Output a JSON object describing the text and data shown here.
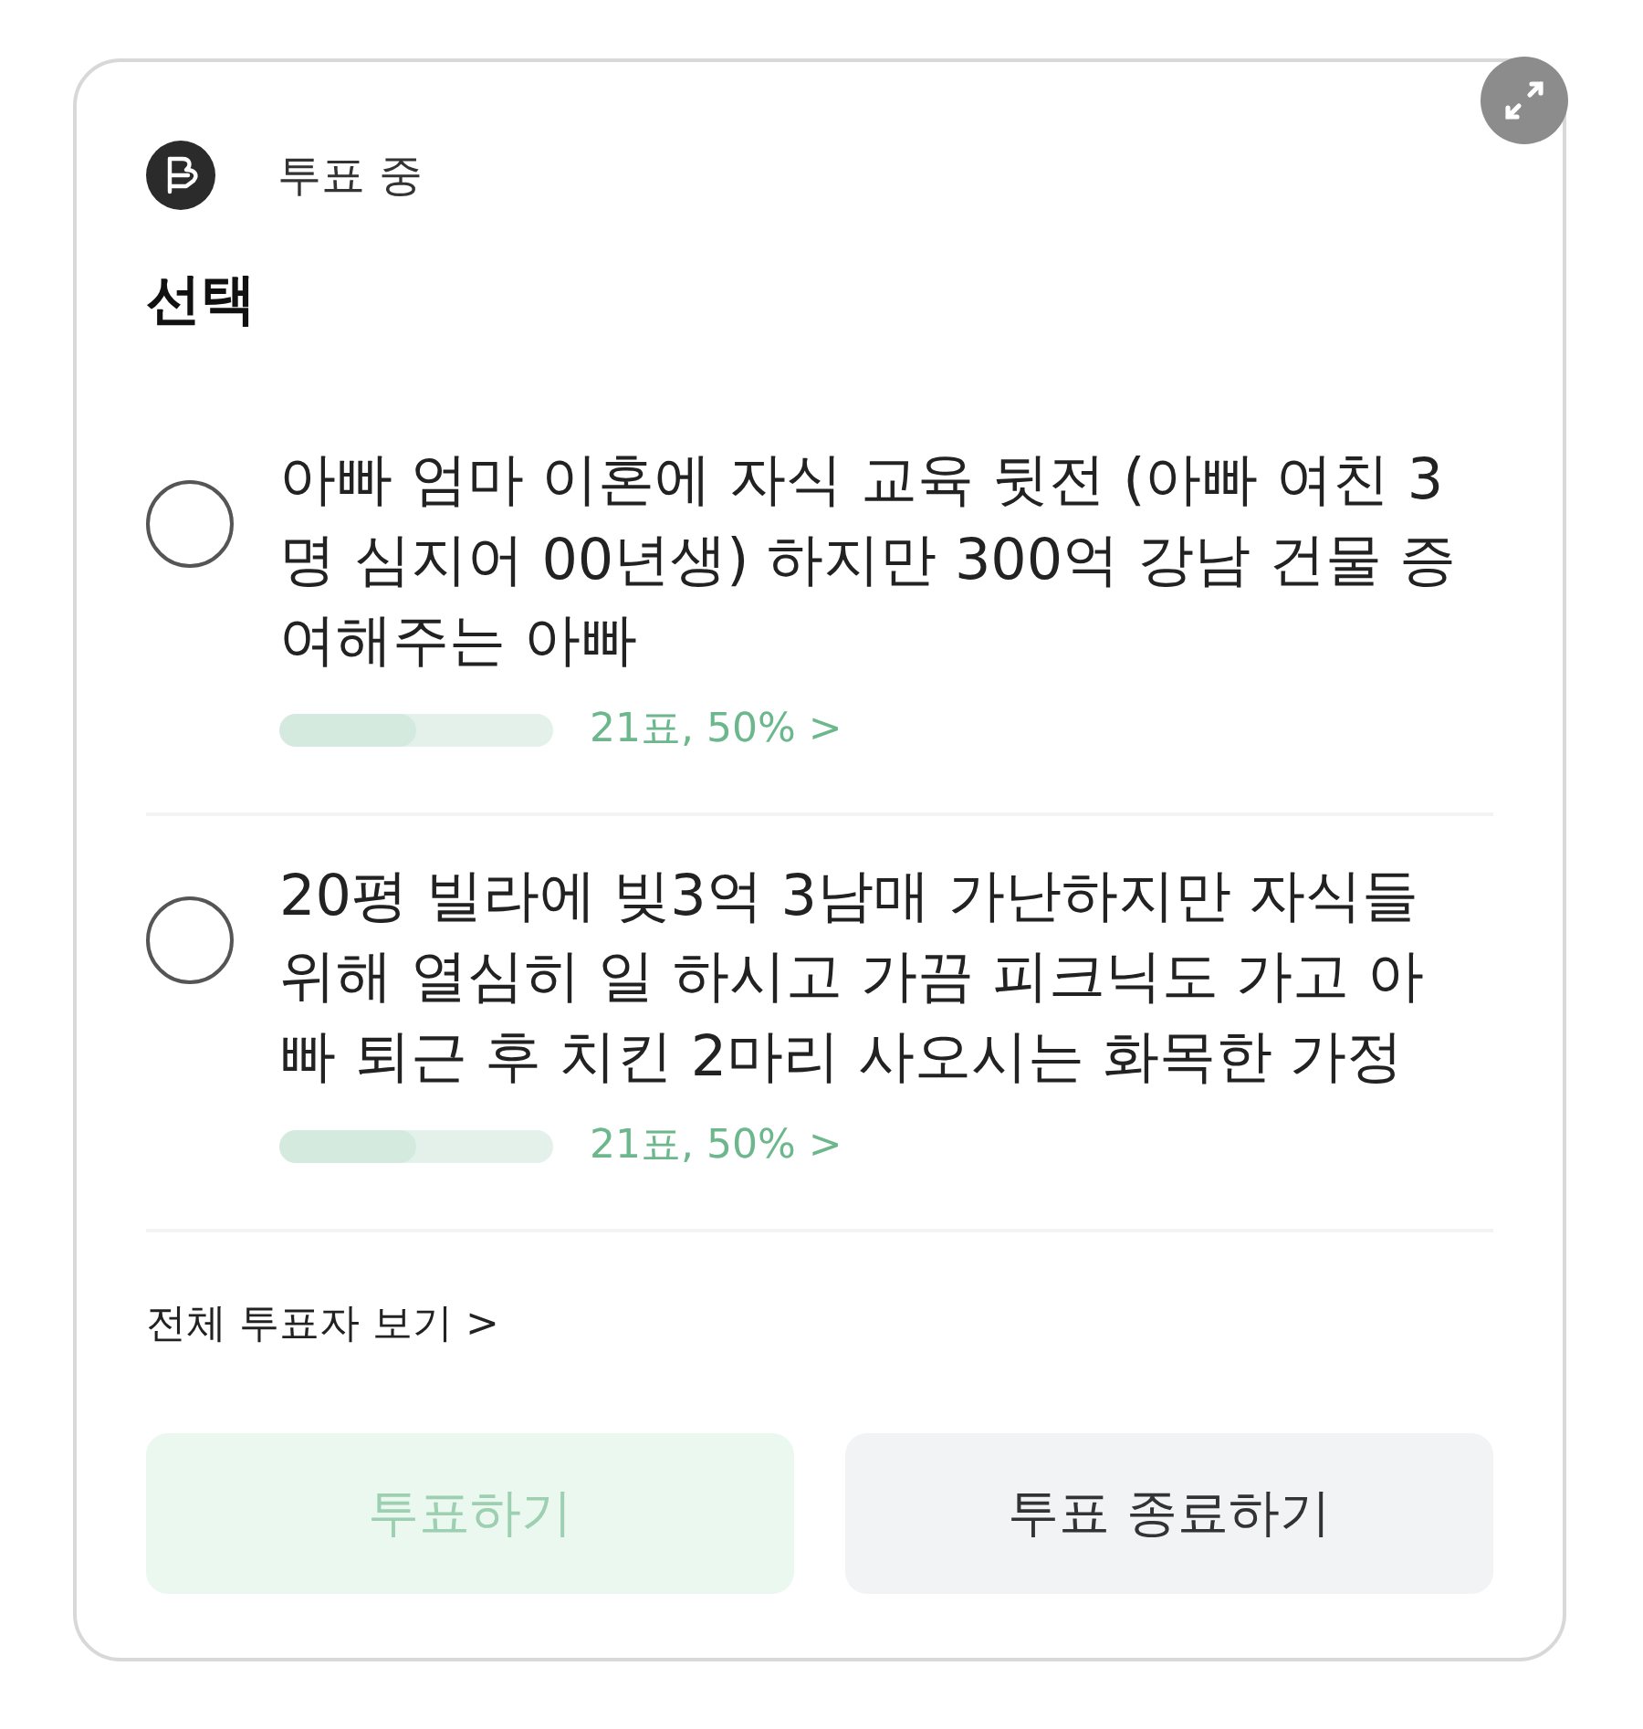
{
  "status": {
    "label": "투표 중"
  },
  "title": "선택",
  "options": [
    {
      "text": "아빠 엄마 이혼에 자식 교육 뒷전 (아빠 여친 3명 심지어 00년생) 하지만 300억 강남 건물 증여해주는 아빠",
      "selected": false,
      "level": 0.5,
      "result": "21표, 50% >"
    },
    {
      "text": "20평 빌라에 빚3억 3남매 가난하지만 자식들 위해 열심히 일 하시고 가끔 피크닉도 가고 아빠 퇴근 후 치킨 2마리 사오시는 화목한 가정",
      "selected": false,
      "level": 0.5,
      "result": "21표, 50% >"
    }
  ],
  "voters_link": "전체 투표자 보기 >",
  "buttons": [
    {
      "label": "투표하기",
      "kind": "primary",
      "disabled": true
    },
    {
      "label": "투표 종료하기",
      "kind": "secondary",
      "disabled": false
    }
  ]
}
